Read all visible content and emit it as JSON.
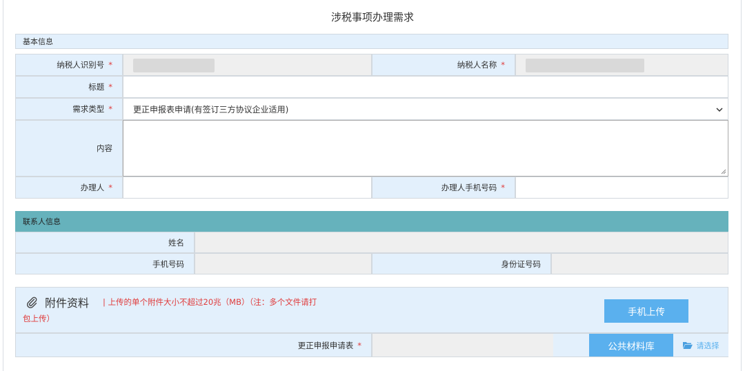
{
  "page_title": "涉税事项办理需求",
  "basic": {
    "section_title": "基本信息",
    "taxpayer_id_label": "纳税人识别号",
    "taxpayer_name_label": "纳税人名称",
    "title_label": "标题",
    "demand_type_label": "需求类型",
    "demand_type_value": "更正申报表申请(有签订三方协议企业适用)",
    "content_label": "内容",
    "handler_label": "办理人",
    "handler_phone_label": "办理人手机号码",
    "required_mark": "*"
  },
  "contact": {
    "section_title": "联系人信息",
    "name_label": "姓名",
    "phone_label": "手机号码",
    "id_label": "身份证号码"
  },
  "attachments": {
    "title": "附件资料",
    "note_line1": "| 上传的单个附件大小不超过20兆（MB）（注：多个文件请打",
    "note_line2": "包上传）",
    "mobile_upload": "手机上传",
    "file_label": "更正申报申请表",
    "public_library": "公共材料库",
    "choose": "请选择"
  },
  "colors": {
    "label_bg": "#e3f0fc",
    "teal_header": "#66b2bc",
    "button_blue": "#5ab0ee",
    "required_red": "#e03b3b"
  }
}
